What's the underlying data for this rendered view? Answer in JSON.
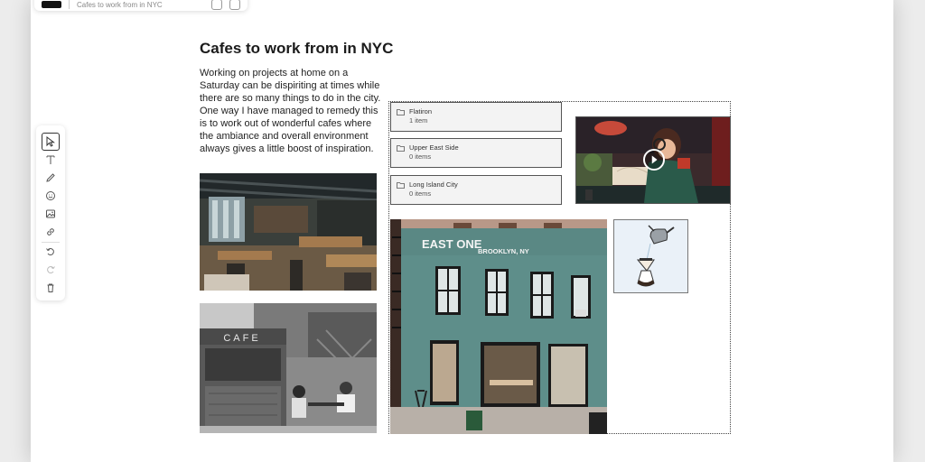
{
  "header": {
    "title": "Cafes to work from in NYC"
  },
  "toolbar": {
    "tools": [
      {
        "name": "select-tool",
        "icon": "cursor-icon"
      },
      {
        "name": "text-tool",
        "icon": "text-icon"
      },
      {
        "name": "pen-tool",
        "icon": "pen-icon"
      },
      {
        "name": "emoji-tool",
        "icon": "smiley-icon"
      },
      {
        "name": "image-tool",
        "icon": "image-icon"
      },
      {
        "name": "link-tool",
        "icon": "link-icon"
      },
      {
        "name": "undo-button",
        "icon": "undo-icon"
      },
      {
        "name": "redo-button",
        "icon": "redo-icon"
      },
      {
        "name": "delete-button",
        "icon": "trash-icon"
      }
    ]
  },
  "page": {
    "title": "Cafes to work from in NYC",
    "intro": "Working on projects at home on a Saturday can be dispiriting at times while there are so many things to do in the city. One way I have managed to remedy this is to work out of wonderful cafes where the ambiance and overall environment always gives a little boost of inspiration."
  },
  "folders": [
    {
      "name": "Flatiron",
      "count": "1 item"
    },
    {
      "name": "Upper East Side",
      "count": "0 items"
    },
    {
      "name": "Long Island City",
      "count": "0 items"
    }
  ],
  "photos": {
    "storefront_sign": "EAST ONE",
    "storefront_sign_sub": "BROOKLYN, NY",
    "kiosk_sign": "CAFE"
  },
  "colors": {
    "storefront_teal": "#5e8e8a",
    "background": "#ececec"
  }
}
